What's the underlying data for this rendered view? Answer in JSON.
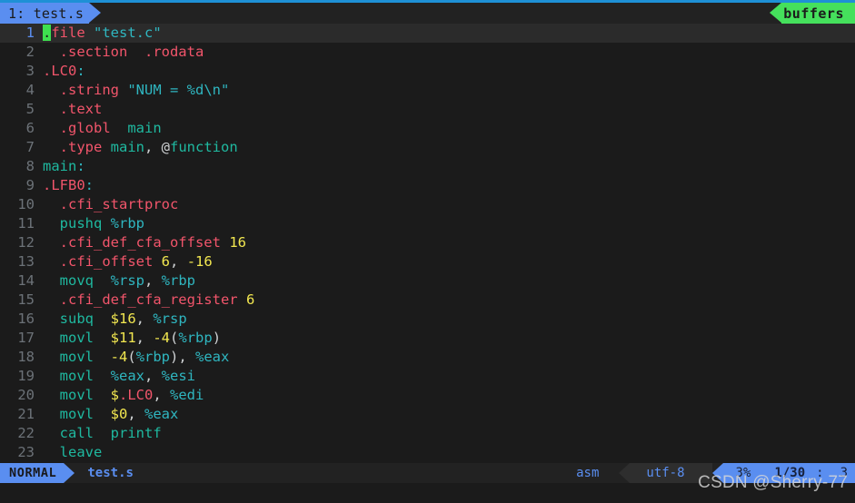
{
  "window": {
    "accent_blue": "#5a8ef0",
    "accent_green": "#45e05c",
    "background": "#1b1b1b"
  },
  "tabline": {
    "active_tab": "1: test.s",
    "buffers_label": "buffers"
  },
  "editor": {
    "filetype": "asm",
    "cursor_char": ".",
    "lines": [
      {
        "n": "1",
        "tokens": [
          {
            "t": ".",
            "c": "cursor"
          },
          {
            "t": "file",
            "c": "dir"
          },
          {
            "t": " ",
            "c": "pun"
          },
          {
            "t": "\"test.c\"",
            "c": "str"
          }
        ]
      },
      {
        "n": "2",
        "tokens": [
          {
            "t": "  .section  .rodata",
            "c": "dir"
          }
        ]
      },
      {
        "n": "3",
        "tokens": [
          {
            "t": ".LC0",
            "c": "dir"
          },
          {
            "t": ":",
            "c": "col"
          }
        ]
      },
      {
        "n": "4",
        "tokens": [
          {
            "t": "  .string",
            "c": "dir"
          },
          {
            "t": " ",
            "c": "pun"
          },
          {
            "t": "\"NUM = %d\\n\"",
            "c": "str"
          }
        ]
      },
      {
        "n": "5",
        "tokens": [
          {
            "t": "  .text",
            "c": "dir"
          }
        ]
      },
      {
        "n": "6",
        "tokens": [
          {
            "t": "  .globl",
            "c": "dir"
          },
          {
            "t": "  ",
            "c": "pun"
          },
          {
            "t": "main",
            "c": "idn"
          }
        ]
      },
      {
        "n": "7",
        "tokens": [
          {
            "t": "  .type",
            "c": "dir"
          },
          {
            "t": " ",
            "c": "pun"
          },
          {
            "t": "main",
            "c": "idn"
          },
          {
            "t": ", ",
            "c": "pun"
          },
          {
            "t": "@",
            "c": "at"
          },
          {
            "t": "function",
            "c": "idn"
          }
        ]
      },
      {
        "n": "8",
        "tokens": [
          {
            "t": "main",
            "c": "idn"
          },
          {
            "t": ":",
            "c": "col"
          }
        ]
      },
      {
        "n": "9",
        "tokens": [
          {
            "t": ".LFB0",
            "c": "dir"
          },
          {
            "t": ":",
            "c": "col"
          }
        ]
      },
      {
        "n": "10",
        "tokens": [
          {
            "t": "  .cfi_startproc",
            "c": "dir"
          }
        ]
      },
      {
        "n": "11",
        "tokens": [
          {
            "t": "  pushq",
            "c": "ins"
          },
          {
            "t": " ",
            "c": "pun"
          },
          {
            "t": "%rbp",
            "c": "reg"
          }
        ]
      },
      {
        "n": "12",
        "tokens": [
          {
            "t": "  .cfi_def_cfa_offset",
            "c": "dir"
          },
          {
            "t": " ",
            "c": "pun"
          },
          {
            "t": "16",
            "c": "num"
          }
        ]
      },
      {
        "n": "13",
        "tokens": [
          {
            "t": "  .cfi_offset",
            "c": "dir"
          },
          {
            "t": " ",
            "c": "pun"
          },
          {
            "t": "6",
            "c": "num"
          },
          {
            "t": ", ",
            "c": "pun"
          },
          {
            "t": "-16",
            "c": "num"
          }
        ]
      },
      {
        "n": "14",
        "tokens": [
          {
            "t": "  movq",
            "c": "ins"
          },
          {
            "t": "  ",
            "c": "pun"
          },
          {
            "t": "%rsp",
            "c": "reg"
          },
          {
            "t": ", ",
            "c": "pun"
          },
          {
            "t": "%rbp",
            "c": "reg"
          }
        ]
      },
      {
        "n": "15",
        "tokens": [
          {
            "t": "  .cfi_def_cfa_register",
            "c": "dir"
          },
          {
            "t": " ",
            "c": "pun"
          },
          {
            "t": "6",
            "c": "num"
          }
        ]
      },
      {
        "n": "16",
        "tokens": [
          {
            "t": "  subq",
            "c": "ins"
          },
          {
            "t": "  ",
            "c": "pun"
          },
          {
            "t": "$16",
            "c": "num"
          },
          {
            "t": ", ",
            "c": "pun"
          },
          {
            "t": "%rsp",
            "c": "reg"
          }
        ]
      },
      {
        "n": "17",
        "tokens": [
          {
            "t": "  movl",
            "c": "ins"
          },
          {
            "t": "  ",
            "c": "pun"
          },
          {
            "t": "$11",
            "c": "num"
          },
          {
            "t": ", ",
            "c": "pun"
          },
          {
            "t": "-4",
            "c": "num"
          },
          {
            "t": "(",
            "c": "pun"
          },
          {
            "t": "%rbp",
            "c": "reg"
          },
          {
            "t": ")",
            "c": "pun"
          }
        ]
      },
      {
        "n": "18",
        "tokens": [
          {
            "t": "  movl",
            "c": "ins"
          },
          {
            "t": "  ",
            "c": "pun"
          },
          {
            "t": "-4",
            "c": "num"
          },
          {
            "t": "(",
            "c": "pun"
          },
          {
            "t": "%rbp",
            "c": "reg"
          },
          {
            "t": "), ",
            "c": "pun"
          },
          {
            "t": "%eax",
            "c": "reg"
          }
        ]
      },
      {
        "n": "19",
        "tokens": [
          {
            "t": "  movl",
            "c": "ins"
          },
          {
            "t": "  ",
            "c": "pun"
          },
          {
            "t": "%eax",
            "c": "reg"
          },
          {
            "t": ", ",
            "c": "pun"
          },
          {
            "t": "%esi",
            "c": "reg"
          }
        ]
      },
      {
        "n": "20",
        "tokens": [
          {
            "t": "  movl",
            "c": "ins"
          },
          {
            "t": "  ",
            "c": "pun"
          },
          {
            "t": "$",
            "c": "num"
          },
          {
            "t": ".LC0",
            "c": "dir"
          },
          {
            "t": ", ",
            "c": "pun"
          },
          {
            "t": "%edi",
            "c": "reg"
          }
        ]
      },
      {
        "n": "21",
        "tokens": [
          {
            "t": "  movl",
            "c": "ins"
          },
          {
            "t": "  ",
            "c": "pun"
          },
          {
            "t": "$0",
            "c": "num"
          },
          {
            "t": ", ",
            "c": "pun"
          },
          {
            "t": "%eax",
            "c": "reg"
          }
        ]
      },
      {
        "n": "22",
        "tokens": [
          {
            "t": "  call",
            "c": "ins"
          },
          {
            "t": "  ",
            "c": "pun"
          },
          {
            "t": "printf",
            "c": "idn"
          }
        ]
      },
      {
        "n": "23",
        "tokens": [
          {
            "t": "  leave",
            "c": "ins"
          }
        ]
      }
    ],
    "cursor_line_index": 0
  },
  "statusline": {
    "mode": "NORMAL",
    "filename": "test.s",
    "filetype": "asm",
    "encoding": "utf-8",
    "percent": "3%",
    "line_of_total": "1/30",
    "separator": ":",
    "column": "3"
  },
  "watermark": {
    "text": "CSDN @Sherry-77"
  }
}
